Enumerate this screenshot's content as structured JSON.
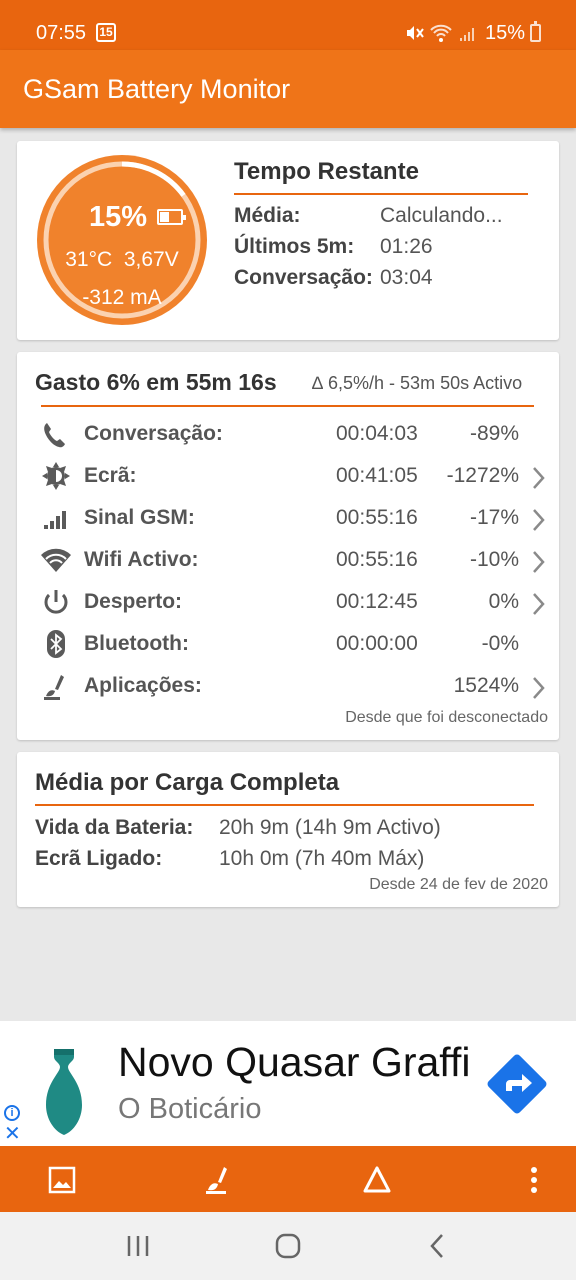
{
  "status_bar": {
    "time": "07:55",
    "calendar_day": "15",
    "battery_percent": "15%"
  },
  "app": {
    "title": "GSam Battery Monitor"
  },
  "battery": {
    "percent": "15%",
    "temperature": "31°C",
    "voltage": "3,67V",
    "current": "-312 mA",
    "level": 0.15
  },
  "tempo_restante": {
    "title": "Tempo Restante",
    "rows": [
      {
        "label": "Média:",
        "value": "Calculando..."
      },
      {
        "label": "Últimos 5m:",
        "value": "01:26"
      },
      {
        "label": "Conversação:",
        "value": "03:04"
      }
    ]
  },
  "usage": {
    "title": "Gasto 6% em 55m 16s",
    "rate": "∆ 6,5%/h - 53m 50s Activo",
    "rows": [
      {
        "icon": "phone-icon",
        "label": "Conversação:",
        "time": "00:04:03",
        "percent": "-89%",
        "chevron": false
      },
      {
        "icon": "brightness-icon",
        "label": "Ecrã:",
        "time": "00:41:05",
        "percent": "-1272%",
        "chevron": true
      },
      {
        "icon": "signal-icon",
        "label": "Sinal GSM:",
        "time": "00:55:16",
        "percent": "-17%",
        "chevron": true
      },
      {
        "icon": "wifi-icon",
        "label": "Wifi Activo:",
        "time": "00:55:16",
        "percent": "-10%",
        "chevron": true
      },
      {
        "icon": "power-icon",
        "label": "Desperto:",
        "time": "00:12:45",
        "percent": "0%",
        "chevron": true
      },
      {
        "icon": "bluetooth-icon",
        "label": "Bluetooth:",
        "time": "00:00:00",
        "percent": "-0%",
        "chevron": false
      },
      {
        "icon": "apps-icon",
        "label": "Aplicações:",
        "time": "",
        "percent": "1524%",
        "chevron": true
      }
    ],
    "since": "Desde que foi desconectado"
  },
  "full_charge": {
    "title": "Média por Carga Completa",
    "rows": [
      {
        "label": "Vida da Bateria:",
        "value": "20h 9m (14h 9m Activo)"
      },
      {
        "label": "Ecrã Ligado:",
        "value": "10h 0m (7h 40m Máx)"
      }
    ],
    "since": "Desde 24 de fev de 2020"
  },
  "ad": {
    "headline": "Novo Quasar Graffi",
    "advertiser": "O Boticário"
  },
  "colors": {
    "primary": "#ef7418",
    "primary_dark": "#e8650f",
    "gauge": "#f0822c"
  }
}
